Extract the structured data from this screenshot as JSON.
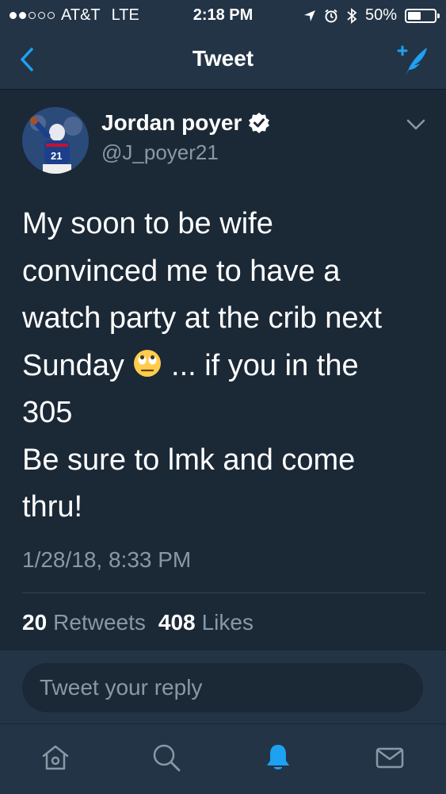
{
  "status_bar": {
    "carrier": "AT&T",
    "network": "LTE",
    "time": "2:18 PM",
    "battery_percent": "50%",
    "battery_level": 0.5,
    "signal_bars_filled": 2,
    "signal_bars_total": 5
  },
  "nav": {
    "title": "Tweet",
    "back_icon": "chevron-left-icon",
    "compose_icon": "compose-tweet-icon"
  },
  "tweet": {
    "author_name": "Jordan poyer",
    "handle": "@J_poyer21",
    "verified": true,
    "text_before_emoji": "My soon to be wife\nconvinced me to have a\nwatch party at the crib next\nSunday ",
    "emoji_name": "eye-roll-emoji",
    "text_after_emoji": " ... if you in the\n305\nBe sure to lmk and come\nthru!",
    "timestamp": "1/28/18, 8:33 PM",
    "retweets_count": "20",
    "retweets_label": "Retweets",
    "likes_count": "408",
    "likes_label": "Likes"
  },
  "reply": {
    "placeholder": "Tweet your reply"
  },
  "tabs": [
    {
      "name": "home",
      "icon": "home-icon",
      "active": false
    },
    {
      "name": "search",
      "icon": "search-icon",
      "active": false
    },
    {
      "name": "notifications",
      "icon": "bell-icon",
      "active": true
    },
    {
      "name": "messages",
      "icon": "envelope-icon",
      "active": false
    }
  ],
  "colors": {
    "background": "#1b2836",
    "bar": "#243447",
    "accent": "#1da1f2",
    "secondary_text": "#8899a6"
  }
}
